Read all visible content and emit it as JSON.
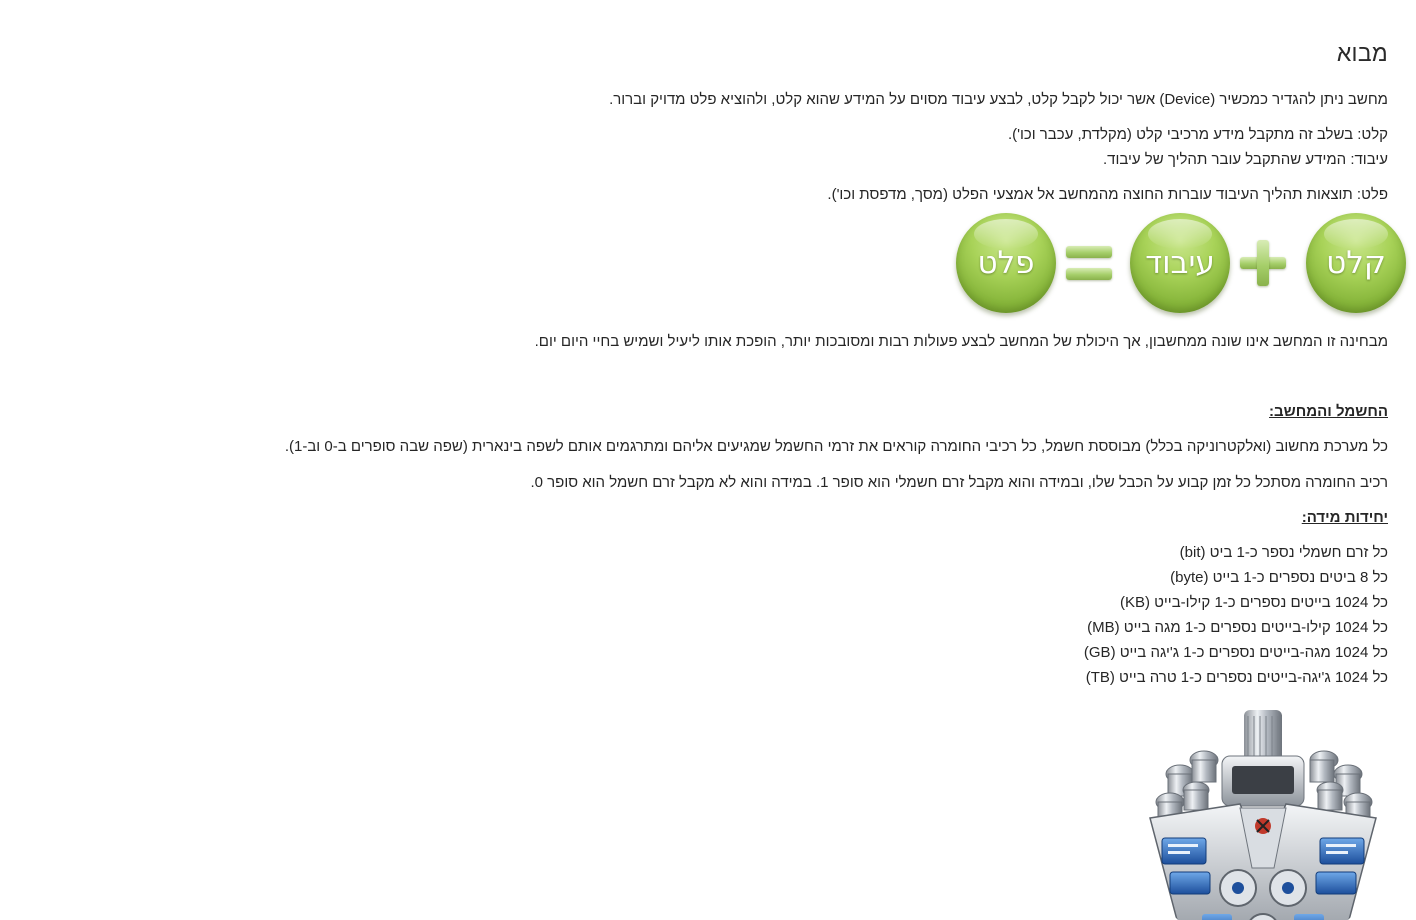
{
  "page_title": "מבוא",
  "intro": "מחשב ניתן להגדיר כמכשיר (Device) אשר יכול לקבל קלט, לבצע עיבוד מסוים על המידע שהוא קלט, ולהוציא פלט מדויק וברור.",
  "input_line": "קלט: בשלב זה מתקבל מידע מרכיבי קלט (מקלדת, עכבר וכו').",
  "processing_line": "עיבוד: המידע שהתקבל עובר תהליך של עיבוד.",
  "output_line": "פלט: תוצאות תהליך העיבוד עוברות החוצה מהמחשב אל אמצעי הפלט (מסך, מדפסת וכו').",
  "diagram": {
    "input": "קלט",
    "processing": "עיבוד",
    "output": "פלט",
    "color": "#9ccb4e"
  },
  "summary": "מבחינה זו המחשב אינו שונה ממחשבון, אך היכולת של המחשב לבצע פעולות רבות ומסובכות יותר, הופכת אותו ליעיל ושמיש בחיי היום יום.",
  "electricity": {
    "heading": "החשמל והמחשב:",
    "p1": "כל מערכת מחשוב (ואלקטרוניקה בכלל) מבוססת חשמל, כל רכיבי החומרה קוראים את זרמי החשמל שמגיעים אליהם ומתרגמים אותם לשפה בינארית (שפה שבה סופרים ב-0 וב-1).",
    "p2": "רכיב החומרה מסתכל כל זמן קבוע על הכבל שלו, ובמידה והוא מקבל זרם חשמלי הוא סופר 1. במידה והוא לא מקבל זרם חשמל הוא סופר 0."
  },
  "units": {
    "heading": "יחידות מידה:",
    "items": [
      "כל זרם חשמלי נספר כ-1 ביט (bit)",
      "כל 8 ביטים נספרים כ-1 בייט (byte)",
      "כל 1024 בייטים נספרים כ-1 קילו-בייט (KB)",
      "כל 1024 קילו-בייטים נספרים כ-1 מגה בייט (MB)",
      "כל 1024 מגה-בייטים נספרים כ-1 ג'יגה בייט (GB)",
      "כל 1024 ג'יגה-בייטים נספרים כ-1 טרה בייט (TB)"
    ]
  }
}
